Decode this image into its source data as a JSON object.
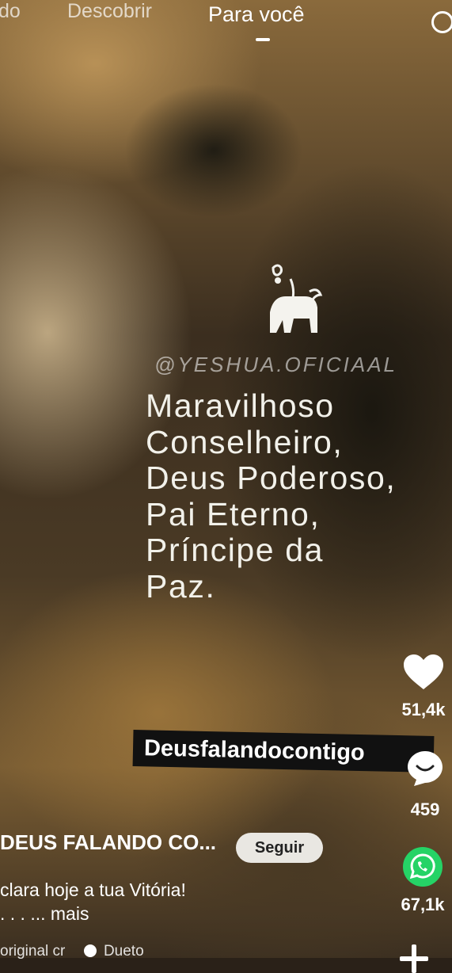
{
  "top_nav": {
    "tabs": [
      {
        "label": "do",
        "active": false
      },
      {
        "label": "Descobrir",
        "active": false
      },
      {
        "label": "Para você",
        "active": true
      }
    ],
    "search_icon": "search-icon"
  },
  "video": {
    "watermark_handle": "@YESHUA.OFICIAAL",
    "verse_lines": [
      "Maravilhoso",
      "Conselheiro,",
      "Deus Poderoso,",
      "Pai Eterno,",
      "Príncipe da",
      "Paz."
    ],
    "caption_banner": "Deusfalandocontigo"
  },
  "actions": {
    "likes": "51,4k",
    "comments": "459",
    "shares": "67,1k",
    "like_icon": "heart-icon",
    "comment_icon": "comment-icon",
    "share_icon": "whatsapp-icon",
    "add_icon": "plus-icon"
  },
  "post": {
    "author": "DEUS FALANDO CO...",
    "follow_label": "Seguir",
    "description_line1": "clara hoje a tua Vitória!",
    "description_line2": ". . . ... mais",
    "music_label": "original cr",
    "duet_label": "Dueto"
  },
  "colors": {
    "whatsapp_green": "#25D366",
    "follow_bg": "#e9e7e2",
    "banner_bg": "#111111"
  }
}
